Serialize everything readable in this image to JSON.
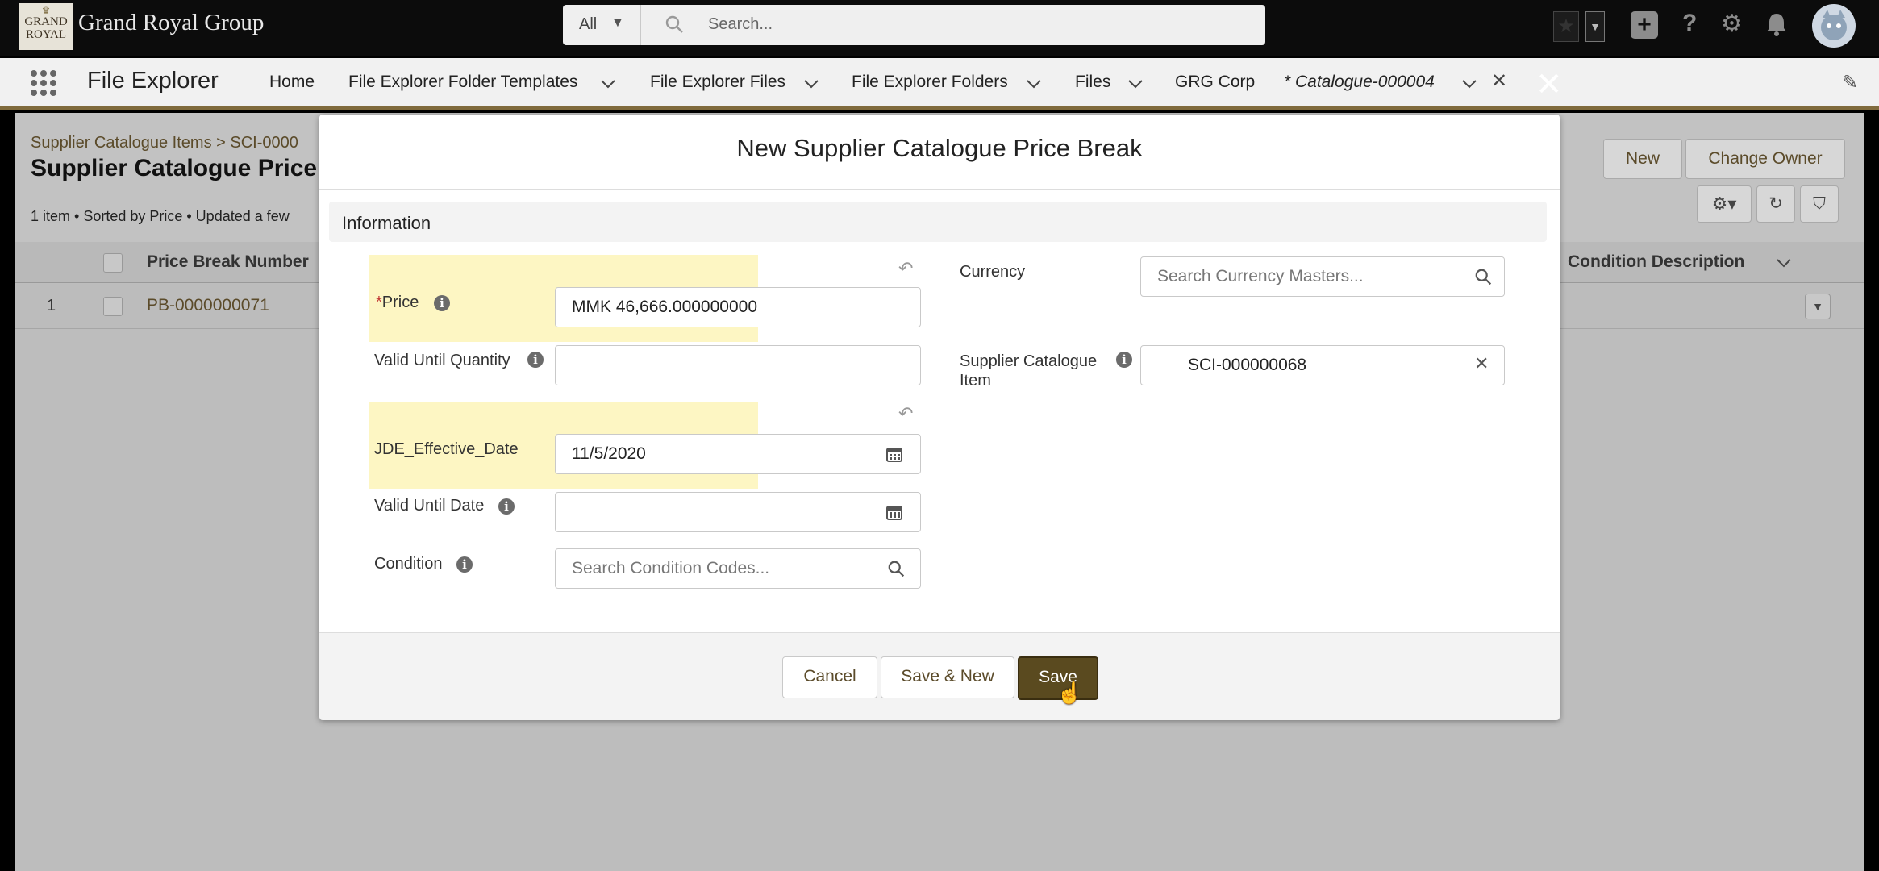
{
  "header": {
    "logo_text_1": "GRAND",
    "logo_text_2": "ROYAL",
    "brand": "Grand Royal Group",
    "search_scope": "All",
    "search_placeholder": "Search..."
  },
  "nav": {
    "app_name": "File Explorer",
    "items": [
      {
        "label": "Home"
      },
      {
        "label": "File Explorer Folder Templates"
      },
      {
        "label": "File Explorer Files"
      },
      {
        "label": "File Explorer Folders"
      },
      {
        "label": "Files"
      },
      {
        "label": "GRG Corp"
      },
      {
        "label": "* Catalogue-000004"
      }
    ]
  },
  "list": {
    "breadcrumb": "Supplier Catalogue Items > SCI-0000",
    "title": "Supplier Catalogue Price B",
    "info": "1 item • Sorted by Price • Updated a few",
    "new_label": "New",
    "change_owner_label": "Change Owner",
    "col_price_break": "Price Break Number",
    "col_condition_desc": "Condition Description",
    "row_num": "1",
    "row_value": "PB-0000000071"
  },
  "modal": {
    "title": "New Supplier Catalogue Price Break",
    "section": "Information",
    "fields": {
      "price_label": "Price",
      "price_value": "MMK 46,666.000000000",
      "valid_qty_label": "Valid Until Quantity",
      "effective_label": "JDE_Effective_Date",
      "effective_value": "11/5/2020",
      "valid_date_label": "Valid Until Date",
      "condition_label": "Condition",
      "condition_placeholder": "Search Condition Codes...",
      "currency_label": "Currency",
      "currency_placeholder": "Search Currency Masters...",
      "sci_label_1": "Supplier Catalogue",
      "sci_label_2": "Item",
      "sci_value": "SCI-000000068"
    },
    "cancel_label": "Cancel",
    "save_new_label": "Save & New",
    "save_label": "Save"
  },
  "colors": {
    "accent": "#5a4a1f",
    "highlight": "#fdf6c3",
    "required": "#c23934"
  }
}
